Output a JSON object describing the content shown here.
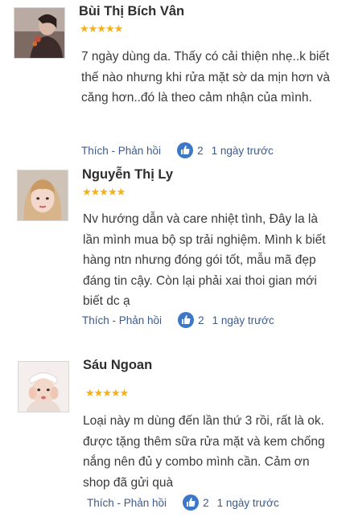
{
  "reviews": [
    {
      "name": "Bùi Thị Bích Vân",
      "stars": "★★★★★",
      "comment": "7 ngày dùng da. Thấy có cải thiện nhẹ..k biết thế nào nhưng khi rửa mặt sờ da mịn hơn và căng hơn..đó là theo cảm nhận của mình.",
      "action_label": "Thích - Phản hồi",
      "likes": "2",
      "time": "1 ngày trước"
    },
    {
      "name": "Nguyễn Thị Ly",
      "stars": "★★★★★",
      "comment": "Nv hướng dẫn và care nhiệt tình, Đây la là lần mình mua bộ sp trải nghiệm. Mình k biết hàng ntn nhưng đóng gói tốt, mẫu mã đẹp đáng tin cậy. Còn lại phải xai thoi gian mới biết dc ạ",
      "action_label": "Thích - Phản hồi",
      "likes": "2",
      "time": "1 ngày trước"
    },
    {
      "name": "Sáu Ngoan",
      "stars": "★★★★★",
      "comment": "Loại này m dùng đến lần thứ 3 rồi, rất là ok. được tặng thêm sữa rửa mặt và kem chống nắng nên đủ y combo mình cần. Cảm ơn shop đã gửi quà",
      "action_label": "Thích - Phản hồi",
      "likes": "2",
      "time": "1 ngày trước"
    }
  ],
  "colors": {
    "star": "#f5b01a",
    "link": "#3b5b8e",
    "like_badge": "#3d78c8"
  },
  "icons": {
    "like": "thumbs-up-icon"
  }
}
